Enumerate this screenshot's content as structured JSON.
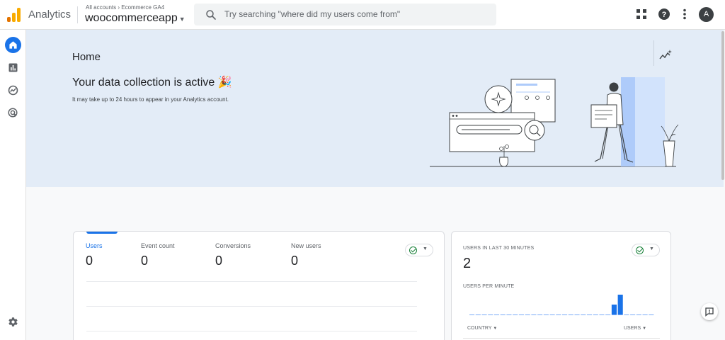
{
  "topbar": {
    "app_name": "Analytics",
    "breadcrumb": "All accounts › Ecommerce GA4",
    "account_name": "woocommerceapp",
    "search_placeholder": "Try searching \"where did my users come from\"",
    "avatar_letter": "A"
  },
  "rail": {
    "items": [
      {
        "icon": "home-icon",
        "active": true
      },
      {
        "icon": "reports-icon"
      },
      {
        "icon": "explore-icon"
      },
      {
        "icon": "advertising-icon"
      }
    ],
    "settings_icon": "gear-icon"
  },
  "hero": {
    "page_title": "Home",
    "title": "Your data collection is active",
    "subtitle": "It may take up to 24 hours to appear in your Analytics account.",
    "emoji": "🎉"
  },
  "overview_card": {
    "metrics": [
      {
        "label": "Users",
        "value": "0"
      },
      {
        "label": "Event count",
        "value": "0"
      },
      {
        "label": "Conversions",
        "value": "0"
      },
      {
        "label": "New users",
        "value": "0"
      }
    ]
  },
  "realtime_card": {
    "title": "USERS IN LAST 30 MINUTES",
    "value": "2",
    "per_minute_label": "USERS PER MINUTE",
    "country_label": "COUNTRY",
    "users_label": "USERS",
    "per_minute_bars": [
      0,
      0,
      0,
      0,
      0,
      0,
      0,
      0,
      0,
      0,
      0,
      0,
      0,
      0,
      0,
      0,
      0,
      0,
      0,
      0,
      0,
      0,
      0,
      1,
      2,
      0,
      0,
      0,
      0,
      0
    ]
  },
  "colors": {
    "accent": "#1a73e8",
    "hero_bg": "#e3ecf7",
    "ok_green": "#188038"
  }
}
